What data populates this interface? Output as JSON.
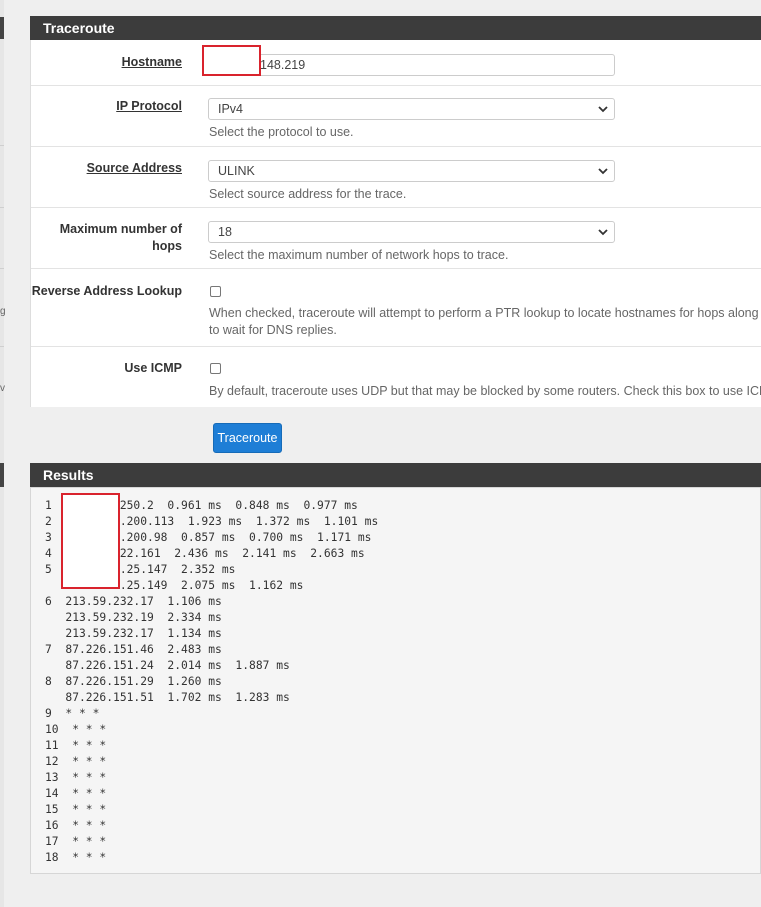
{
  "traceroute": {
    "title": "Traceroute",
    "hostname": {
      "label": "Hostname",
      "value": "148.219"
    },
    "ip_protocol": {
      "label": "IP Protocol",
      "value": "IPv4",
      "help": "Select the protocol to use."
    },
    "source_address": {
      "label": "Source Address",
      "value": "ULINK",
      "help": "Select source address for the trace."
    },
    "max_hops": {
      "label_line1": "Maximum number of",
      "label_line2": "hops",
      "value": "18",
      "help": "Select the maximum number of network hops to trace."
    },
    "reverse_lookup": {
      "label": "Reverse Address Lookup",
      "help_line1": "When checked, traceroute will attempt to perform a PTR lookup to locate hostnames for hops along",
      "help_line2": "to wait for DNS replies."
    },
    "use_icmp": {
      "label": "Use ICMP",
      "help": "By default, traceroute uses UDP but that may be blocked by some routers. Check this box to use ICM"
    },
    "button_label": "Traceroute"
  },
  "results": {
    "title": "Results",
    "lines": [
      "1          250.2  0.961 ms  0.848 ms  0.977 ms",
      "2          .200.113  1.923 ms  1.372 ms  1.101 ms",
      "3          .200.98  0.857 ms  0.700 ms  1.171 ms",
      "4          22.161  2.436 ms  2.141 ms  2.663 ms",
      "5          .25.147  2.352 ms",
      "           .25.149  2.075 ms  1.162 ms",
      "6  213.59.232.17  1.106 ms",
      "   213.59.232.19  2.334 ms",
      "   213.59.232.17  1.134 ms",
      "7  87.226.151.46  2.483 ms",
      "   87.226.151.24  2.014 ms  1.887 ms",
      "8  87.226.151.29  1.260 ms",
      "   87.226.151.51  1.702 ms  1.283 ms",
      "9  * * *",
      "10  * * *",
      "11  * * *",
      "12  * * *",
      "13  * * *",
      "14  * * *",
      "15  * * *",
      "16  * * *",
      "17  * * *",
      "18  * * *"
    ]
  },
  "edge_glyphs": [
    "g",
    "v"
  ],
  "colors": {
    "heading_bg": "#3c3c3c",
    "button_bg": "#1e7ed6",
    "redaction_border": "#d9232d"
  }
}
